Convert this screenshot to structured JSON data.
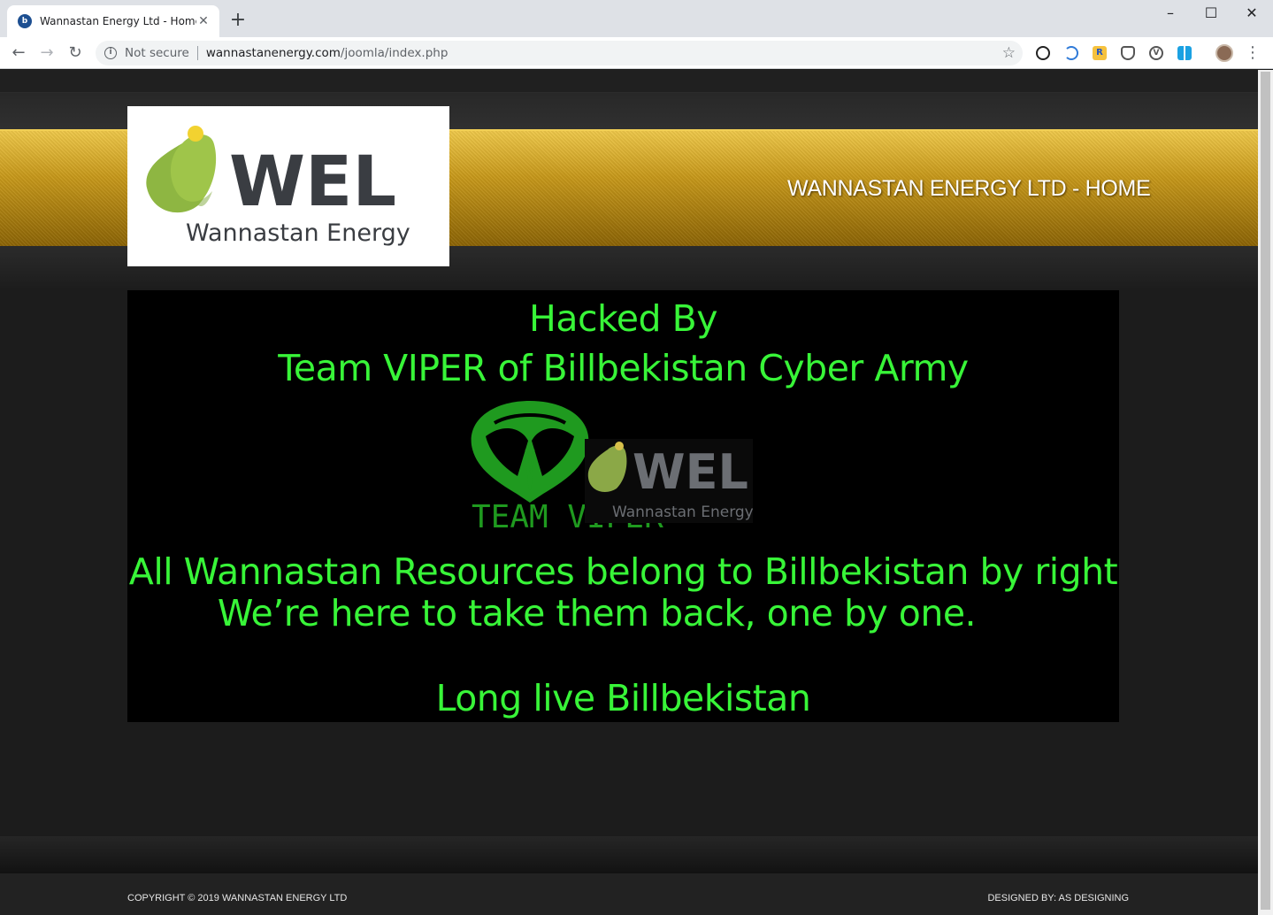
{
  "browser": {
    "tab_title": "Wannastan Energy Ltd - Home",
    "security_label": "Not secure",
    "url_host": "wannastanenergy.com",
    "url_path": "/joomla/index.php"
  },
  "site": {
    "logo_main": "WEL",
    "logo_sub": "Wannastan Energy",
    "header_title": "WANNASTAN ENERGY LTD - HOME"
  },
  "defacement": {
    "line1": "Hacked By",
    "line2": "Team VIPER of Billbekistan Cyber Army",
    "emblem_text": "TEAM VIPER",
    "emblem_logo_main": "WEL",
    "emblem_logo_sub": "Wannastan Energy",
    "line3": "All Wannastan Resources belong to Billbekistan by right",
    "line4": "We’re here to take them back, one by one.",
    "line5": "Long live Billbekistan"
  },
  "footer": {
    "copyright": "COPYRIGHT © 2019 WANNASTAN ENERGY LTD",
    "designed_by": "DESIGNED BY:  AS DESIGNING"
  },
  "colors": {
    "hack_green": "#38f538",
    "gold": "#c99a1b",
    "logo_green": "#9fc54a",
    "logo_dark": "#3a3d42"
  }
}
